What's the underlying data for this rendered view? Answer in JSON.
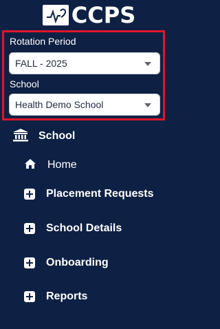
{
  "brand": {
    "name": "CCPS"
  },
  "filters": {
    "rotation_period": {
      "label": "Rotation Period",
      "value": "FALL - 2025"
    },
    "school": {
      "label": "School",
      "value": "Health Demo School"
    }
  },
  "sidebar": {
    "section": {
      "label": "School",
      "icon": "bank-building-icon"
    },
    "items": [
      {
        "label": "Home",
        "icon": "home-icon"
      },
      {
        "label": "Placement Requests",
        "icon": "plus-square-icon"
      },
      {
        "label": "School Details",
        "icon": "plus-square-icon"
      },
      {
        "label": "Onboarding",
        "icon": "plus-square-icon"
      },
      {
        "label": "Reports",
        "icon": "plus-square-icon"
      }
    ]
  },
  "colors": {
    "background": "#0e2144",
    "highlight_border": "#e0162b",
    "text": "#ffffff"
  }
}
